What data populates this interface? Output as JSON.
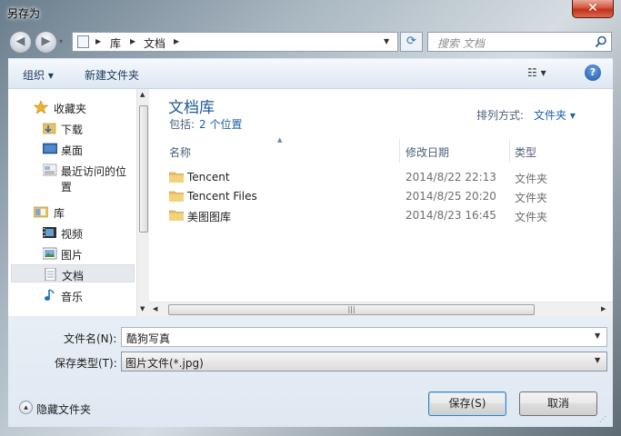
{
  "window": {
    "title": "另存为",
    "close_label": "✕"
  },
  "nav": {
    "back_icon": "◀",
    "forward_icon": "▶",
    "breadcrumb": [
      "库",
      "文档"
    ],
    "search_placeholder": "搜索 文档"
  },
  "toolbar": {
    "organize": "组织 ▾",
    "new_folder": "新建文件夹",
    "view": "☷ ▾",
    "help": "?"
  },
  "sidebar": {
    "favorites_title": "收藏夹",
    "favorites": [
      "下载",
      "桌面",
      "最近访问的位置"
    ],
    "libraries_title": "库",
    "libraries": [
      "视频",
      "图片",
      "文档",
      "音乐"
    ],
    "selected": "文档"
  },
  "library": {
    "title": "文档库",
    "include_label": "包括:",
    "locations": "2 个位置",
    "arrange_label": "排列方式:",
    "arrange_value": "文件夹 ▾"
  },
  "columns": [
    "名称",
    "修改日期",
    "类型"
  ],
  "files": [
    {
      "name": "Tencent",
      "date": "2014/8/22 22:13",
      "type": "文件夹"
    },
    {
      "name": "Tencent Files",
      "date": "2014/8/25 20:20",
      "type": "文件夹"
    },
    {
      "name": "美图图库",
      "date": "2014/8/23 16:45",
      "type": "文件夹"
    }
  ],
  "form": {
    "filename_label": "文件名(N):",
    "filename_value": "酷狗写真",
    "filetype_label": "保存类型(T):",
    "filetype_value": "图片文件(*.jpg)"
  },
  "footer": {
    "hide_folders": "隐藏文件夹",
    "save": "保存(S)",
    "cancel": "取消"
  },
  "colors": {
    "accent": "#1e5a96",
    "link": "#1b5fa8",
    "close_red": "#c0311a"
  }
}
